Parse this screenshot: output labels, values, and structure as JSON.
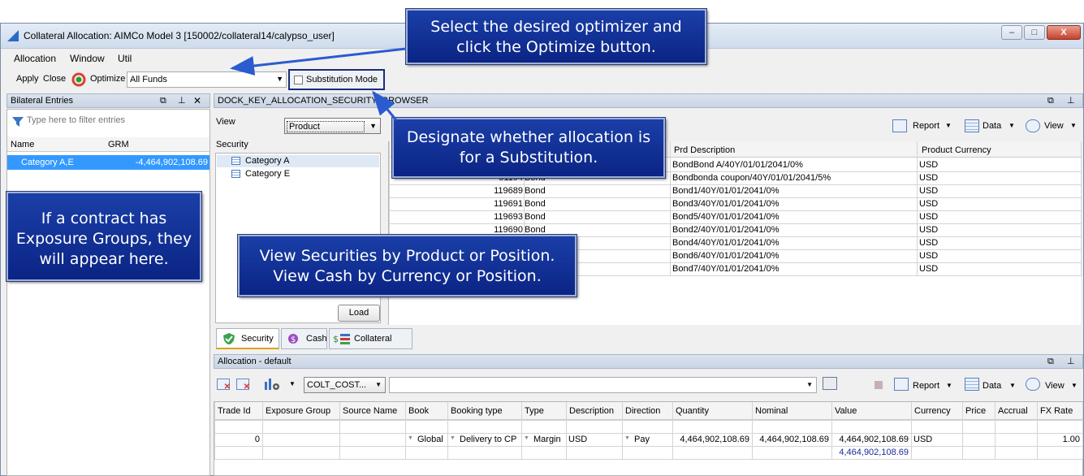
{
  "window": {
    "title": "Collateral Allocation: AIMCo Model 3 [150002/collateral14/calypso_user]",
    "min": "–",
    "max": "□",
    "close": "X"
  },
  "menu": [
    "Allocation",
    "Window",
    "Util"
  ],
  "toolbar": {
    "apply": "Apply",
    "close": "Close",
    "optimize": "Optimize",
    "fund": "All Funds",
    "substitution": "Substitution Mode"
  },
  "bilateral": {
    "title": "Bilateral Entries",
    "filter_placeholder": "Type here to filter entries",
    "col_name": "Name",
    "col_grm": "GRM",
    "row_name": "Category A,E",
    "row_grm": "-4,464,902,108.69"
  },
  "browser": {
    "title": "DOCK_KEY_ALLOCATION_SECURITY_BROWSER",
    "view_label": "View",
    "view_value": "Product",
    "security_label": "Security",
    "tree": [
      "Category A",
      "Category E"
    ],
    "load": "Load",
    "report": "Report",
    "data": "Data",
    "view": "View",
    "col_desc": "Prd Description",
    "col_ccy": "Product Currency",
    "rows": [
      {
        "id": "",
        "type": "",
        "desc": "BondBond A/40Y/01/01/2041/0%",
        "ccy": "USD"
      },
      {
        "id": "51194",
        "type": "Bond",
        "desc": "Bondbonda coupon/40Y/01/01/2041/5%",
        "ccy": "USD"
      },
      {
        "id": "119689",
        "type": "Bond",
        "desc": "Bond1/40Y/01/01/2041/0%",
        "ccy": "USD"
      },
      {
        "id": "119691",
        "type": "Bond",
        "desc": "Bond3/40Y/01/01/2041/0%",
        "ccy": "USD"
      },
      {
        "id": "119693",
        "type": "Bond",
        "desc": "Bond5/40Y/01/01/2041/0%",
        "ccy": "USD"
      },
      {
        "id": "119690",
        "type": "Bond",
        "desc": "Bond2/40Y/01/01/2041/0%",
        "ccy": "USD"
      },
      {
        "id": "",
        "type": "",
        "desc": "Bond4/40Y/01/01/2041/0%",
        "ccy": "USD"
      },
      {
        "id": "",
        "type": "",
        "desc": "Bond6/40Y/01/01/2041/0%",
        "ccy": "USD"
      },
      {
        "id": "",
        "type": "",
        "desc": "Bond7/40Y/01/01/2041/0%",
        "ccy": "USD"
      }
    ]
  },
  "tabs": [
    "Security",
    "Cash",
    "Collateral Pool"
  ],
  "allocation": {
    "title": "Allocation - default",
    "colt": "COLT_COST...",
    "report": "Report",
    "data": "Data",
    "view": "View",
    "columns": [
      "Trade Id",
      "Exposure Group",
      "Source Name",
      "Book",
      "Booking type",
      "Type",
      "Description",
      "Direction",
      "Quantity",
      "Nominal",
      "Value",
      "Currency",
      "Price",
      "Accrual",
      "FX Rate"
    ],
    "row": {
      "trade_id": "0",
      "book": "Global",
      "booking_type": "Delivery to CP",
      "type": "Margin",
      "description": "USD",
      "direction": "Pay",
      "quantity": "4,464,902,108.69",
      "nominal": "4,464,902,108.69",
      "value": "4,464,902,108.69",
      "currency": "USD",
      "fx_rate": "1.00"
    },
    "total_value": "4,464,902,108.69"
  },
  "callouts": {
    "optimizer": "Select the desired optimizer and click the Optimize button.",
    "substitution": "Designate whether allocation is for a Substitution.",
    "exposure": "If a contract has Exposure Groups, they will appear here.",
    "view": "View Securities by Product or Position. View Cash by Currency or Position."
  },
  "colors": {
    "callout": "#0b2485",
    "selection": "#3399ff",
    "panel_header": "#c9d4e3"
  }
}
